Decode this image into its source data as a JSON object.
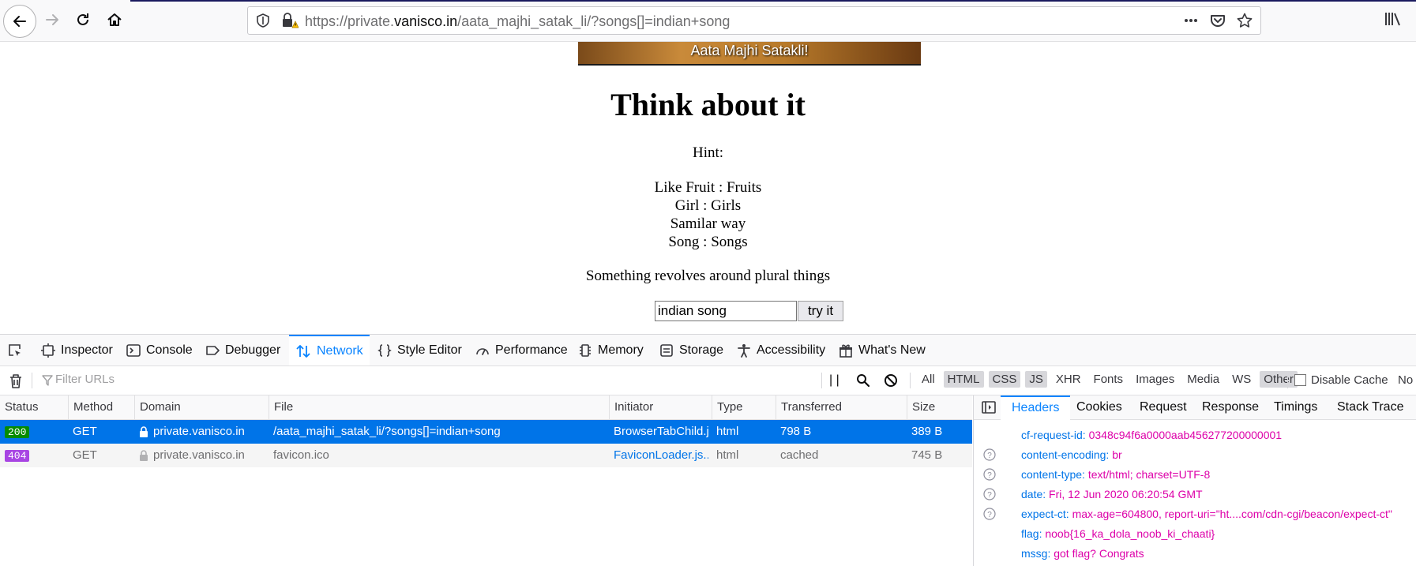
{
  "browser": {
    "url_prefix": "https://private.",
    "url_host": "vanisco.in",
    "url_path": "/aata_majhi_satak_li/?songs[]=indian+song"
  },
  "page": {
    "banner_text": "Aata Majhi Satakli!",
    "title": "Think about it",
    "hint_label": "Hint:",
    "hint_lines": [
      "Like Fruit : Fruits",
      "Girl : Girls",
      "Samilar way",
      "Song : Songs"
    ],
    "plural_note": "Something revolves around plural things",
    "input_value": "indian song",
    "button_label": "try it"
  },
  "devtools": {
    "tabs": [
      "Inspector",
      "Console",
      "Debugger",
      "Network",
      "Style Editor",
      "Performance",
      "Memory",
      "Storage",
      "Accessibility",
      "What's New"
    ],
    "filter_placeholder": "Filter URLs",
    "pause_label": "| |",
    "type_filters": [
      "All",
      "HTML",
      "CSS",
      "JS",
      "XHR",
      "Fonts",
      "Images",
      "Media",
      "WS",
      "Other"
    ],
    "disable_cache_label": "Disable Cache",
    "throttle_label": "No",
    "columns": [
      "Status",
      "Method",
      "Domain",
      "File",
      "Initiator",
      "Type",
      "Transferred",
      "Size"
    ],
    "requests": [
      {
        "status": "200",
        "method": "GET",
        "domain": "private.vanisco.in",
        "file": "/aata_majhi_satak_li/?songs[]=indian+song",
        "initiator": "BrowserTabChild.j...",
        "type": "html",
        "transferred": "798 B",
        "size": "389 B"
      },
      {
        "status": "404",
        "method": "GET",
        "domain": "private.vanisco.in",
        "file": "favicon.ico",
        "initiator": "FaviconLoader.js...",
        "type": "html",
        "transferred": "cached",
        "size": "745 B"
      }
    ],
    "side_tabs": [
      "Headers",
      "Cookies",
      "Request",
      "Response",
      "Timings",
      "Stack Trace"
    ],
    "headers": [
      {
        "name": "cf-request-id:",
        "value": "0348c94f6a0000aab456277200000001",
        "help": false
      },
      {
        "name": "content-encoding:",
        "value": "br",
        "help": true
      },
      {
        "name": "content-type:",
        "value": "text/html; charset=UTF-8",
        "help": true
      },
      {
        "name": "date:",
        "value": "Fri, 12 Jun 2020 06:20:54 GMT",
        "help": true
      },
      {
        "name": "expect-ct:",
        "value": "max-age=604800, report-uri=\"ht....com/cdn-cgi/beacon/expect-ct\"",
        "help": true
      },
      {
        "name": "flag:",
        "value": "noob{16_ka_dola_noob_ki_chaati}",
        "help": false
      },
      {
        "name": "mssg:",
        "value": "got flag? Congrats",
        "help": false
      }
    ]
  }
}
